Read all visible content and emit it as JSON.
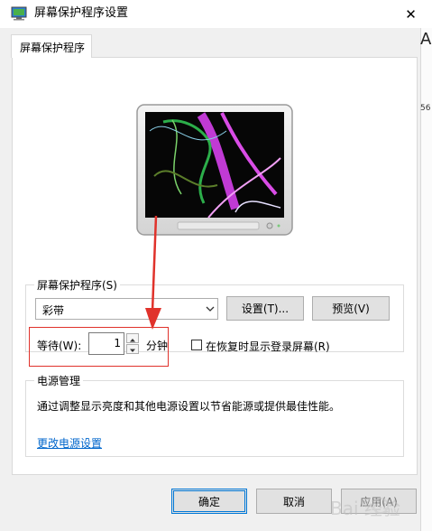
{
  "window": {
    "title": "屏幕保护程序设置"
  },
  "tab": {
    "label": "屏幕保护程序"
  },
  "screensaver": {
    "group_title": "屏幕保护程序(S)",
    "selected": "彩带",
    "settings_label": "设置(T)...",
    "preview_label": "预览(V)",
    "wait_label": "等待(W):",
    "wait_value": "1",
    "wait_unit": "分钟",
    "logon_label": "在恢复时显示登录屏幕(R)",
    "logon_checked": false
  },
  "power": {
    "group_title": "电源管理",
    "description": "通过调整显示亮度和其他电源设置以节省能源或提供最佳性能。",
    "link": "更改电源设置"
  },
  "footer": {
    "ok_label": "确定",
    "cancel_label": "取消",
    "apply_label": "应用(A)"
  },
  "background": {
    "edge_letter": "A",
    "edge_number": "56"
  },
  "watermark": {
    "text": "Bai 经验"
  },
  "colors": {
    "accent": "#0078d7",
    "annotation": "#e0322b",
    "link": "#0066cc"
  }
}
